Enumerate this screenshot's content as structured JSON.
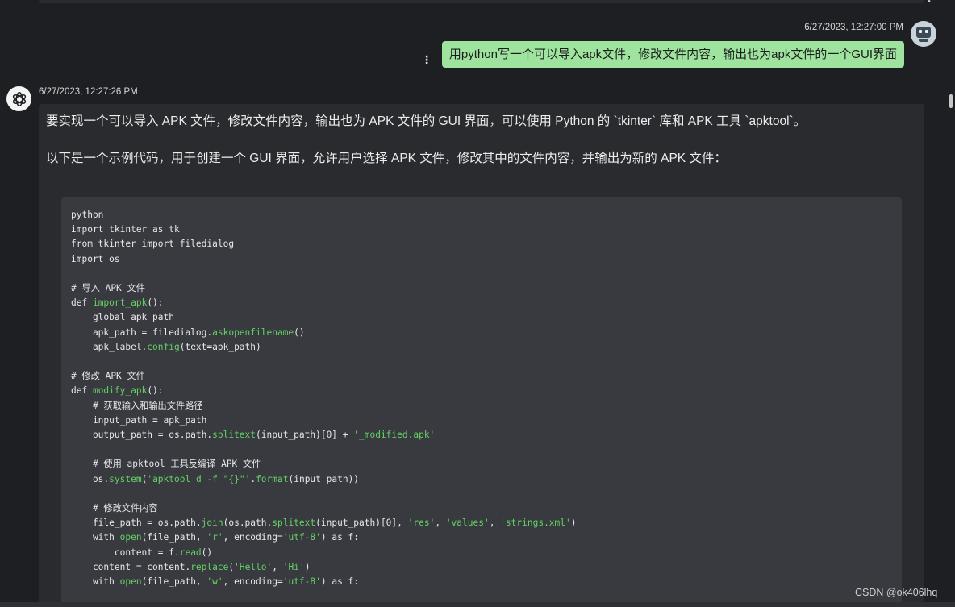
{
  "user_message": {
    "timestamp": "6/27/2023, 12:27:00 PM",
    "text": "用python写一个可以导入apk文件，修改文件内容，输出也为apk文件的一个GUI界面"
  },
  "bot_message": {
    "timestamp": "6/27/2023, 12:27:26 PM",
    "para1": "要实现一个可以导入 APK 文件，修改文件内容，输出也为 APK 文件的 GUI 界面，可以使用 Python 的 `tkinter` 库和 APK 工具 `apktool`。",
    "para2": "以下是一个示例代码，用于创建一个 GUI 界面，允许用户选择 APK 文件，修改其中的文件内容，并输出为新的 APK 文件：",
    "code_lines": [
      [
        [
          "python"
        ]
      ],
      [
        [
          "import tkinter as tk"
        ]
      ],
      [
        [
          "from tkinter import filedialog"
        ]
      ],
      [
        [
          "import os"
        ]
      ],
      [
        [
          ""
        ]
      ],
      [
        [
          "# 导入 APK 文件"
        ]
      ],
      [
        [
          "def "
        ],
        [
          "import_apk",
          "kw"
        ],
        [
          "():"
        ]
      ],
      [
        [
          "    global apk_path"
        ]
      ],
      [
        [
          "    apk_path = filedialog."
        ],
        [
          "askopenfilename",
          "kw"
        ],
        [
          "()"
        ]
      ],
      [
        [
          "    apk_label."
        ],
        [
          "config",
          "kw"
        ],
        [
          "(text=apk_path)"
        ]
      ],
      [
        [
          ""
        ]
      ],
      [
        [
          "# 修改 APK 文件"
        ]
      ],
      [
        [
          "def "
        ],
        [
          "modify_apk",
          "kw"
        ],
        [
          "():"
        ]
      ],
      [
        [
          "    # 获取输入和输出文件路径"
        ]
      ],
      [
        [
          "    input_path = apk_path"
        ]
      ],
      [
        [
          "    output_path = os.path."
        ],
        [
          "splitext",
          "kw"
        ],
        [
          "(input_path)[0] + "
        ],
        [
          "'_modified.apk'",
          "kw"
        ]
      ],
      [
        [
          ""
        ]
      ],
      [
        [
          "    # 使用 apktool 工具反编译 APK 文件"
        ]
      ],
      [
        [
          "    os."
        ],
        [
          "system",
          "kw"
        ],
        [
          "("
        ],
        [
          "'apktool d -f \"{}\"'",
          "kw"
        ],
        [
          "."
        ],
        [
          "format",
          "kw"
        ],
        [
          "(input_path))"
        ]
      ],
      [
        [
          ""
        ]
      ],
      [
        [
          "    # 修改文件内容"
        ]
      ],
      [
        [
          "    file_path = os.path."
        ],
        [
          "join",
          "kw"
        ],
        [
          "(os.path."
        ],
        [
          "splitext",
          "kw"
        ],
        [
          "(input_path)[0], "
        ],
        [
          "'res'",
          "kw"
        ],
        [
          ", "
        ],
        [
          "'values'",
          "kw"
        ],
        [
          ", "
        ],
        [
          "'strings.xml'",
          "kw"
        ],
        [
          ")"
        ]
      ],
      [
        [
          "    with "
        ],
        [
          "open",
          "kw"
        ],
        [
          "(file_path, "
        ],
        [
          "'r'",
          "kw"
        ],
        [
          ", encoding="
        ],
        [
          "'utf-8'",
          "kw"
        ],
        [
          ") as f:"
        ]
      ],
      [
        [
          "        content = f."
        ],
        [
          "read",
          "kw"
        ],
        [
          "()"
        ]
      ],
      [
        [
          "    content = content."
        ],
        [
          "replace",
          "kw"
        ],
        [
          "("
        ],
        [
          "'Hello'",
          "kw"
        ],
        [
          ", "
        ],
        [
          "'Hi'",
          "kw"
        ],
        [
          ")"
        ]
      ],
      [
        [
          "    with "
        ],
        [
          "open",
          "kw"
        ],
        [
          "(file_path, "
        ],
        [
          "'w'",
          "kw"
        ],
        [
          ", encoding="
        ],
        [
          "'utf-8'",
          "kw"
        ],
        [
          ") as f:"
        ]
      ]
    ]
  },
  "watermark": "CSDN @ok406lhq",
  "colors": {
    "user_bubble": "#9ee49e",
    "code_bg": "#383a40",
    "keyword": "#64d264"
  },
  "icons": [
    "openai-logo-icon",
    "robot-avatar-icon",
    "kebab-menu-icon"
  ]
}
